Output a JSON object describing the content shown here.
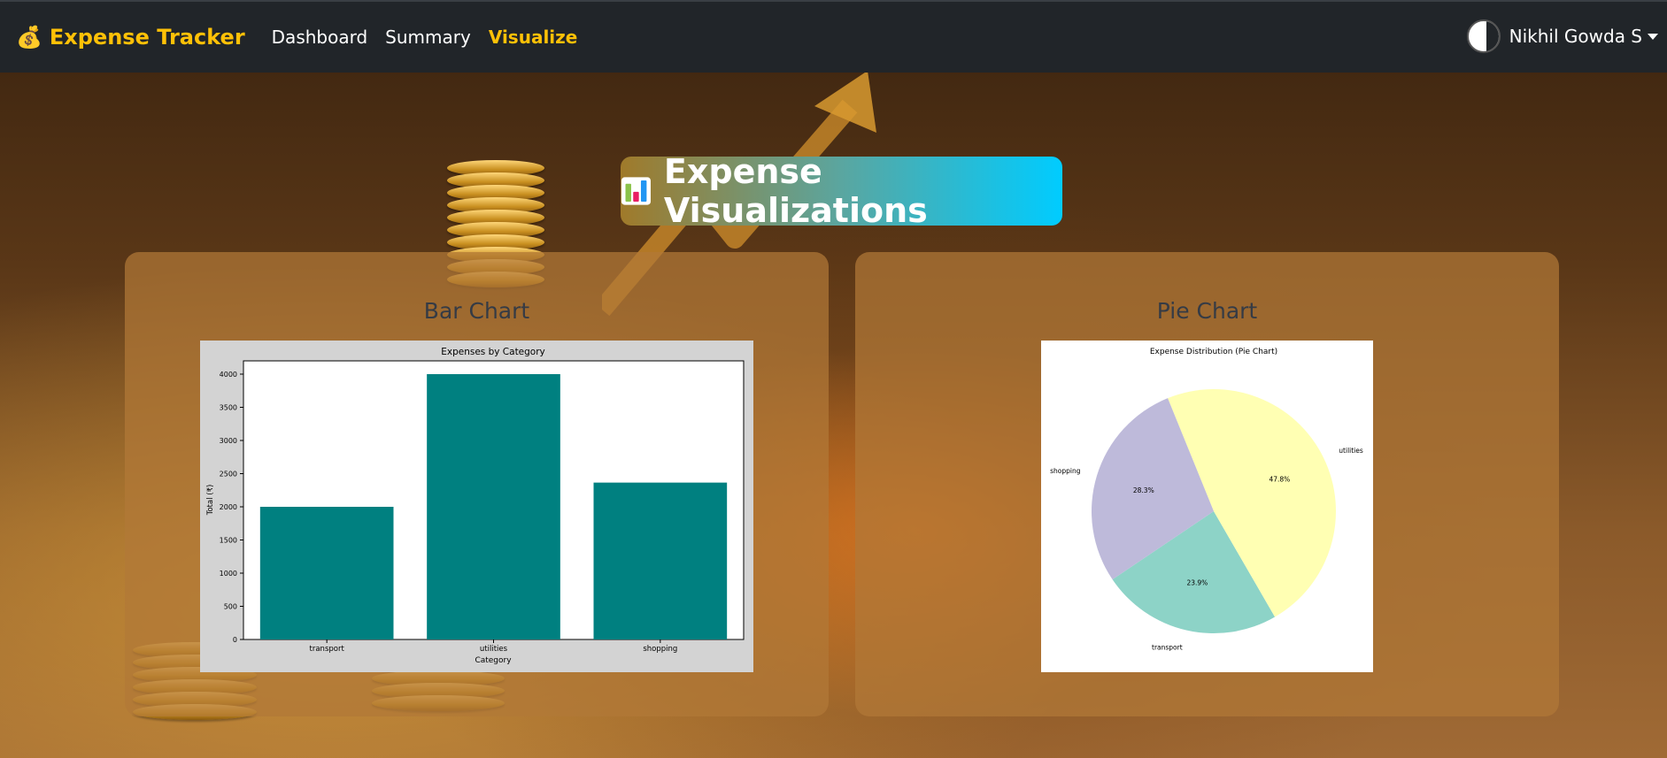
{
  "navbar": {
    "brand_icon": "money-bag-icon",
    "brand": "Expense Tracker",
    "links": [
      {
        "label": "Dashboard",
        "active": false
      },
      {
        "label": "Summary",
        "active": false
      },
      {
        "label": "Visualize",
        "active": true
      }
    ],
    "user_name": "Nikhil Gowda S"
  },
  "header": {
    "icon": "bar-chart-icon",
    "title": "Expense Visualizations"
  },
  "cards": {
    "bar": {
      "title": "Bar Chart"
    },
    "pie": {
      "title": "Pie Chart"
    }
  },
  "colors": {
    "accent": "#ffc107",
    "navbar": "#212529",
    "bar_fill": "#008080",
    "pie_transport": "#8dd3c7",
    "pie_utilities": "#ffffb3",
    "pie_shopping": "#bebada"
  },
  "chart_data": [
    {
      "type": "bar",
      "title": "Expenses by Category",
      "xlabel": "Category",
      "ylabel": "Total (₹)",
      "categories": [
        "transport",
        "utilities",
        "shopping"
      ],
      "values": [
        2000,
        4000,
        2365
      ],
      "ylim": [
        0,
        4200
      ],
      "yticks": [
        0,
        500,
        1000,
        1500,
        2000,
        2500,
        3000,
        3500,
        4000
      ],
      "grid": false
    },
    {
      "type": "pie",
      "title": "Expense Distribution (Pie Chart)",
      "slices": [
        {
          "label": "transport",
          "value": 23.9,
          "pct_label": "23.9%"
        },
        {
          "label": "utilities",
          "value": 47.8,
          "pct_label": "47.8%"
        },
        {
          "label": "shopping",
          "value": 28.3,
          "pct_label": "28.3%"
        }
      ]
    }
  ]
}
